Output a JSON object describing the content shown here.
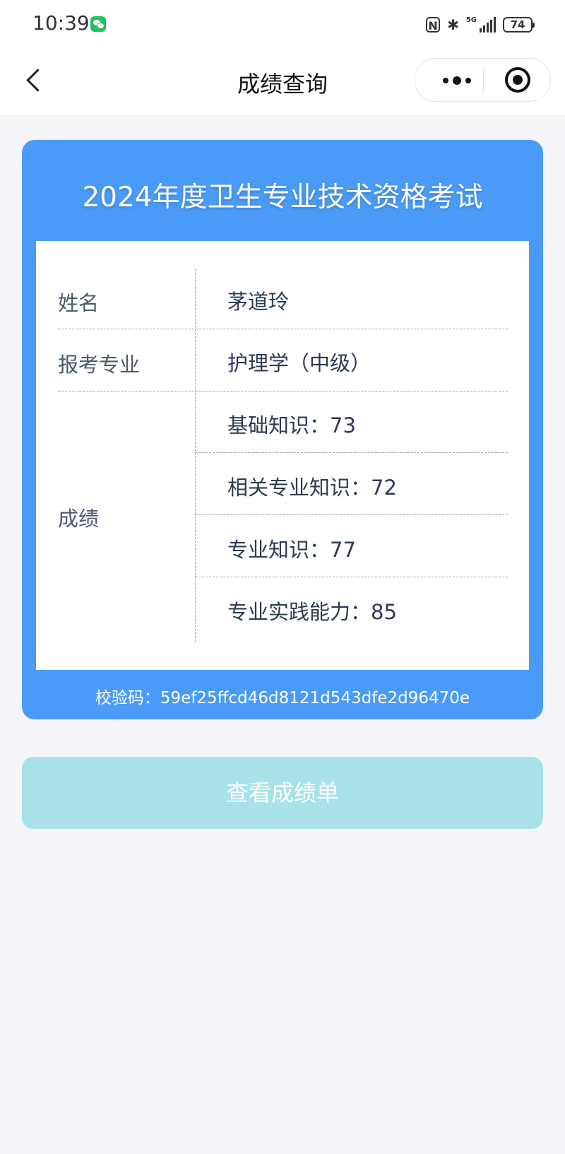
{
  "status_bar": {
    "time": "10:39",
    "network": "5G",
    "battery": "74"
  },
  "nav": {
    "title": "成绩查询"
  },
  "card": {
    "title": "2024年度卫生专业技术资格考试",
    "rows": {
      "name_label": "姓名",
      "name_value": "茅道玲",
      "major_label": "报考专业",
      "major_value": "护理学（中级）",
      "score_label": "成绩"
    },
    "scores": [
      "基础知识：73",
      "相关专业知识：72",
      "专业知识：77",
      "专业实践能力：85"
    ],
    "check_code": "校验码：59ef25ffcd46d8121d543dfe2d96470e"
  },
  "actions": {
    "view_transcript": "查看成绩单"
  },
  "colors": {
    "card_blue": "#4a9bf7",
    "button_disabled": "#a8e2e8",
    "page_bg": "#f3f5f9"
  }
}
